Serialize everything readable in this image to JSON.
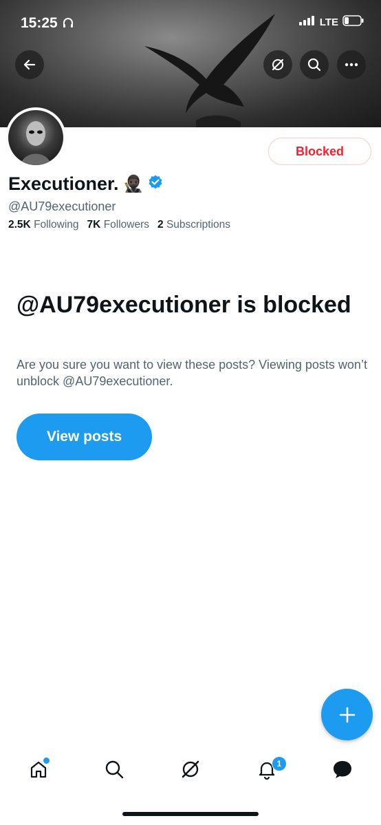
{
  "status_bar": {
    "time": "15:25",
    "network": "LTE"
  },
  "profile": {
    "name": "Executioner.",
    "name_emoji": "🥷🏿",
    "handle": "@AU79executioner",
    "blocked_label": "Blocked",
    "stats": {
      "following_count": "2.5K",
      "following_label": "Following",
      "followers_count": "7K",
      "followers_label": "Followers",
      "subscriptions_count": "2",
      "subscriptions_label": "Subscriptions"
    }
  },
  "blocked_notice": {
    "title": "@AU79executioner is blocked",
    "description": "Are you sure you want to view these posts? Viewing posts won’t unblock @AU79executioner.",
    "view_button": "View posts"
  },
  "tabbar": {
    "notifications_badge": "1"
  },
  "colors": {
    "accent": "#1d9bf0",
    "blocked_red": "#f4212e",
    "muted": "#536471"
  },
  "icons": [
    "back-arrow-icon",
    "grok-icon",
    "search-icon",
    "more-icon",
    "verified-icon",
    "plus-icon",
    "home-icon",
    "explore-icon",
    "grok-tab-icon",
    "notifications-icon",
    "messages-icon"
  ]
}
